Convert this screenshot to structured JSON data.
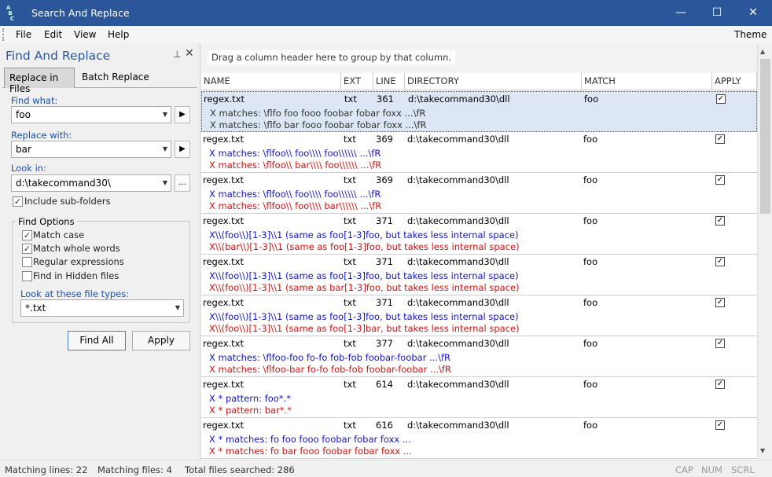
{
  "window": {
    "title": "Search And Replace",
    "icon": "abc-app-icon",
    "minimize_glyph": "—",
    "maximize_glyph": "☐",
    "close_glyph": "✕"
  },
  "menu": {
    "items": [
      "File",
      "Edit",
      "View",
      "Help"
    ],
    "theme": "Theme"
  },
  "panel": {
    "title": "Find And Replace",
    "pin_glyph": "⊥",
    "close_glyph": "✕",
    "tabs": [
      "Replace in Files",
      "Batch Replace"
    ],
    "active_tab": "Replace in Files",
    "find_label": "Find what:",
    "find_value": "foo",
    "replace_label": "Replace with:",
    "replace_value": "bar",
    "lookin_label": "Look in:",
    "lookin_value": "d:\\takecommand30\\",
    "browse_label": "...",
    "include_subfolders": {
      "label": "Include sub-folders",
      "checked": true
    },
    "find_options": {
      "title": "Find Options",
      "match_case": {
        "label": "Match case",
        "checked": true
      },
      "match_whole_words": {
        "label": "Match whole words",
        "checked": true
      },
      "regular_expressions": {
        "label": "Regular expressions",
        "checked": false
      },
      "find_hidden": {
        "label": "Find in Hidden files",
        "checked": false
      },
      "filetypes_label": "Look at these file types:",
      "filetypes_value": "*.txt"
    },
    "find_all_label": "Find All",
    "apply_label": "Apply"
  },
  "grid": {
    "group_hint": "Drag a column header here to group by that column.",
    "columns": [
      "NAME",
      "EXT",
      "LINE",
      "DIRECTORY",
      "MATCH",
      "APPLY"
    ],
    "rows": [
      {
        "name": "regex.txt",
        "ext": "txt",
        "line": "361",
        "dir": "d:\\takecommand30\\dll",
        "match": "foo",
        "apply": true,
        "selected": true,
        "line1": "X matches: \\flfo foo fooo foobar fobar foxx ...\\fR",
        "line2": "X matches: \\flfo bar fooo foobar fobar foxx ...\\fR"
      },
      {
        "name": "regex.txt",
        "ext": "txt",
        "line": "369",
        "dir": "d:\\takecommand30\\dll",
        "match": "foo",
        "apply": true,
        "selected": false,
        "line1": "X matches: \\flfoo\\\\ foo\\\\\\\\ foo\\\\\\\\\\\\  ...\\fR",
        "line2": "X matches: \\flfoo\\\\ bar\\\\\\\\ foo\\\\\\\\\\\\  ...\\fR"
      },
      {
        "name": "regex.txt",
        "ext": "txt",
        "line": "369",
        "dir": "d:\\takecommand30\\dll",
        "match": "foo",
        "apply": true,
        "selected": false,
        "line1": "X matches: \\flfoo\\\\ foo\\\\\\\\ foo\\\\\\\\\\\\  ...\\fR",
        "line2": "X matches: \\flfoo\\\\ foo\\\\\\\\ bar\\\\\\\\\\\\  ...\\fR"
      },
      {
        "name": "regex.txt",
        "ext": "txt",
        "line": "371",
        "dir": "d:\\takecommand30\\dll",
        "match": "foo",
        "apply": true,
        "selected": false,
        "line1": "X\\\\(foo\\\\)[1-3]\\\\1 (same as foo[1-3]foo, but takes less internal space)",
        "line2": "X\\\\(bar\\\\)[1-3]\\\\1 (same as foo[1-3]foo, but takes less internal space)"
      },
      {
        "name": "regex.txt",
        "ext": "txt",
        "line": "371",
        "dir": "d:\\takecommand30\\dll",
        "match": "foo",
        "apply": true,
        "selected": false,
        "line1": "X\\\\(foo\\\\)[1-3]\\\\1 (same as foo[1-3]foo, but takes less internal space)",
        "line2": "X\\\\(foo\\\\)[1-3]\\\\1 (same as bar[1-3]foo, but takes less internal space)"
      },
      {
        "name": "regex.txt",
        "ext": "txt",
        "line": "371",
        "dir": "d:\\takecommand30\\dll",
        "match": "foo",
        "apply": true,
        "selected": false,
        "line1": "X\\\\(foo\\\\)[1-3]\\\\1 (same as foo[1-3]foo, but takes less internal space)",
        "line2": "X\\\\(foo\\\\)[1-3]\\\\1 (same as foo[1-3]bar, but takes less internal space)"
      },
      {
        "name": "regex.txt",
        "ext": "txt",
        "line": "377",
        "dir": "d:\\takecommand30\\dll",
        "match": "foo",
        "apply": true,
        "selected": false,
        "line1": "X matches: \\flfoo-foo fo-fo fob-fob foobar-foobar ...\\fR",
        "line2": "X matches: \\flfoo-bar fo-fo fob-fob foobar-foobar ...\\fR"
      },
      {
        "name": "regex.txt",
        "ext": "txt",
        "line": "614",
        "dir": "d:\\takecommand30\\dll",
        "match": "foo",
        "apply": true,
        "selected": false,
        "line1": "X * pattern: foo*.*",
        "line2": "X * pattern: bar*.*"
      },
      {
        "name": "regex.txt",
        "ext": "txt",
        "line": "616",
        "dir": "d:\\takecommand30\\dll",
        "match": "foo",
        "apply": true,
        "selected": false,
        "line1": "X * matches: fo foo fooo foobar fobar foxx ...",
        "line2": "X * matches: fo bar fooo foobar fobar foxx ..."
      }
    ]
  },
  "status": {
    "matching_lines": "Matching lines: 22",
    "matching_files": "Matching files: 4",
    "total_files": "Total files searched: 286",
    "cap": "CAP",
    "num": "NUM",
    "scrl": "SCRL"
  },
  "colors": {
    "title_bar": "#2b579a",
    "selected_row": "#dce6f5",
    "original_line": "#1414c8",
    "replaced_line": "#d01414"
  }
}
